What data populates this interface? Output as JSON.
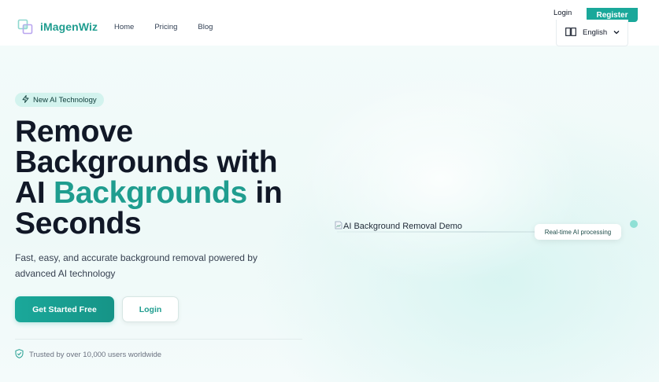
{
  "brand": {
    "name": "iMagenWiz",
    "icon": "overlapping-squares-logo-icon"
  },
  "nav": {
    "items": [
      {
        "label": "Home"
      },
      {
        "label": "Pricing"
      },
      {
        "label": "Blog"
      }
    ]
  },
  "header": {
    "login_label": "Login",
    "register_label": "Register",
    "language": {
      "icon": "book-icon",
      "selected": "English",
      "caret_icon": "chevron-down-icon"
    }
  },
  "hero": {
    "badge": {
      "icon": "lightning-icon",
      "label": "New AI Technology"
    },
    "title": {
      "line1": "Remove",
      "line2": "Backgrounds with",
      "line3_pre": "AI",
      "line3_accent": "Backgrounds",
      "line3_post": "in",
      "line4": "Seconds"
    },
    "subtitle": "Fast, easy, and accurate background removal powered by advanced AI technology",
    "cta_primary": "Get Started Free",
    "cta_secondary": "Login",
    "trust": {
      "icon": "shield-check-icon",
      "text": "Trusted by over 10,000 users worldwide"
    }
  },
  "demo": {
    "broken_image_alt": "AI Background Removal Demo",
    "chip": "Real-time AI processing"
  },
  "colors": {
    "brand": "#1f9d8f",
    "primary_button": "#1aa89a",
    "title": "#111827",
    "badge_bg": "#d3f3ee"
  }
}
